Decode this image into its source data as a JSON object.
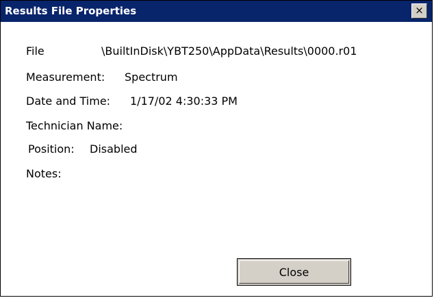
{
  "window": {
    "title": "Results File Properties",
    "close_glyph": "×",
    "titlebar_color": "#08246b"
  },
  "fields": {
    "file_label": "File",
    "file_value": "\\BuiltInDisk\\YBT250\\AppData\\Results\\0000.r01",
    "measurement_label": "Measurement:",
    "measurement_value": "Spectrum",
    "datetime_label": "Date and Time:",
    "datetime_value": "1/17/02 4:30:33 PM",
    "technician_label": "Technician Name:",
    "position_label": "Position:",
    "position_value": "Disabled",
    "notes_label": "Notes:"
  },
  "buttons": {
    "close_label": "Close"
  }
}
